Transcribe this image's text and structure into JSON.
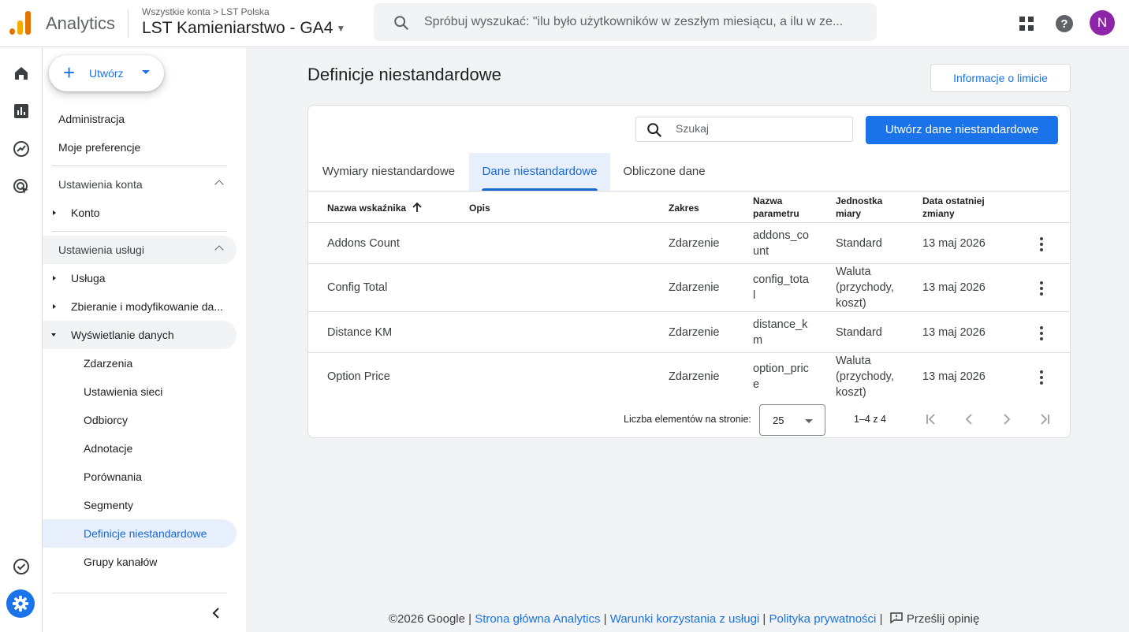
{
  "header": {
    "brand": "Analytics",
    "breadcrumb_all": "Wszystkie konta",
    "breadcrumb_sep": ">",
    "breadcrumb_account": "LST Polska",
    "property": "LST Kamieniarstwo - GA4",
    "search_placeholder": "Spróbuj wyszukać: \"ilu było użytkowników w zeszłym miesiącu, a ilu w ze...",
    "avatar_letter": "N"
  },
  "nav": {
    "create_label": "Utwórz",
    "admin": "Administracja",
    "preferences": "Moje preferencje",
    "account_settings": "Ustawienia konta",
    "account": "Konto",
    "service_settings": "Ustawienia usługi",
    "service": "Usługa",
    "data_collection": "Zbieranie i modyfikowanie da...",
    "data_display": "Wyświetlanie danych",
    "sub_items": [
      "Zdarzenia",
      "Ustawienia sieci",
      "Odbiorcy",
      "Adnotacje",
      "Porównania",
      "Segmenty",
      "Definicje niestandardowe",
      "Grupy kanałów"
    ]
  },
  "main": {
    "title": "Definicje niestandardowe",
    "limit_button": "Informacje o limicie",
    "search_placeholder": "Szukaj",
    "create_button": "Utwórz dane niestandardowe",
    "tabs": [
      "Wymiary niestandardowe",
      "Dane niestandardowe",
      "Obliczone dane"
    ],
    "columns": {
      "name": "Nazwa wskaźnika",
      "desc": "Opis",
      "scope": "Zakres",
      "param_1": "Nazwa",
      "param_2": "parametru",
      "unit_1": "Jednostka",
      "unit_2": "miary",
      "date_1": "Data ostatniej",
      "date_2": "zmiany"
    },
    "rows": [
      {
        "name": "Addons Count",
        "scope": "Zdarzenie",
        "param_1": "addons_co",
        "param_2": "unt",
        "unit_1": "Standard",
        "unit_2": "",
        "unit_3": "",
        "date": "13 maj 2026"
      },
      {
        "name": "Config Total",
        "scope": "Zdarzenie",
        "param_1": "config_tota",
        "param_2": "l",
        "unit_1": "Waluta",
        "unit_2": "(przychody,",
        "unit_3": "koszt)",
        "date": "13 maj 2026"
      },
      {
        "name": "Distance KM",
        "scope": "Zdarzenie",
        "param_1": "distance_k",
        "param_2": "m",
        "unit_1": "Standard",
        "unit_2": "",
        "unit_3": "",
        "date": "13 maj 2026"
      },
      {
        "name": "Option Price",
        "scope": "Zdarzenie",
        "param_1": "option_pric",
        "param_2": "e",
        "unit_1": "Waluta",
        "unit_2": "(przychody,",
        "unit_3": "koszt)",
        "date": "13 maj 2026"
      }
    ],
    "pagination": {
      "per_page_label": "Liczba elementów na stronie:",
      "per_page": "25",
      "range": "1–4 z 4"
    }
  },
  "footer": {
    "copyright": "©2026 Google",
    "sep": "|",
    "link_home": "Strona główna Analytics",
    "link_terms": "Warunki korzystania z usługi",
    "link_privacy": "Polityka prywatności",
    "feedback": "Prześlij opinię"
  },
  "colors": {
    "accent": "#1a73e8",
    "active_bg": "#e8f0fe",
    "avatar": "#8e24aa",
    "logo_orange": "#f9ab00",
    "logo_dark_orange": "#e37400"
  }
}
